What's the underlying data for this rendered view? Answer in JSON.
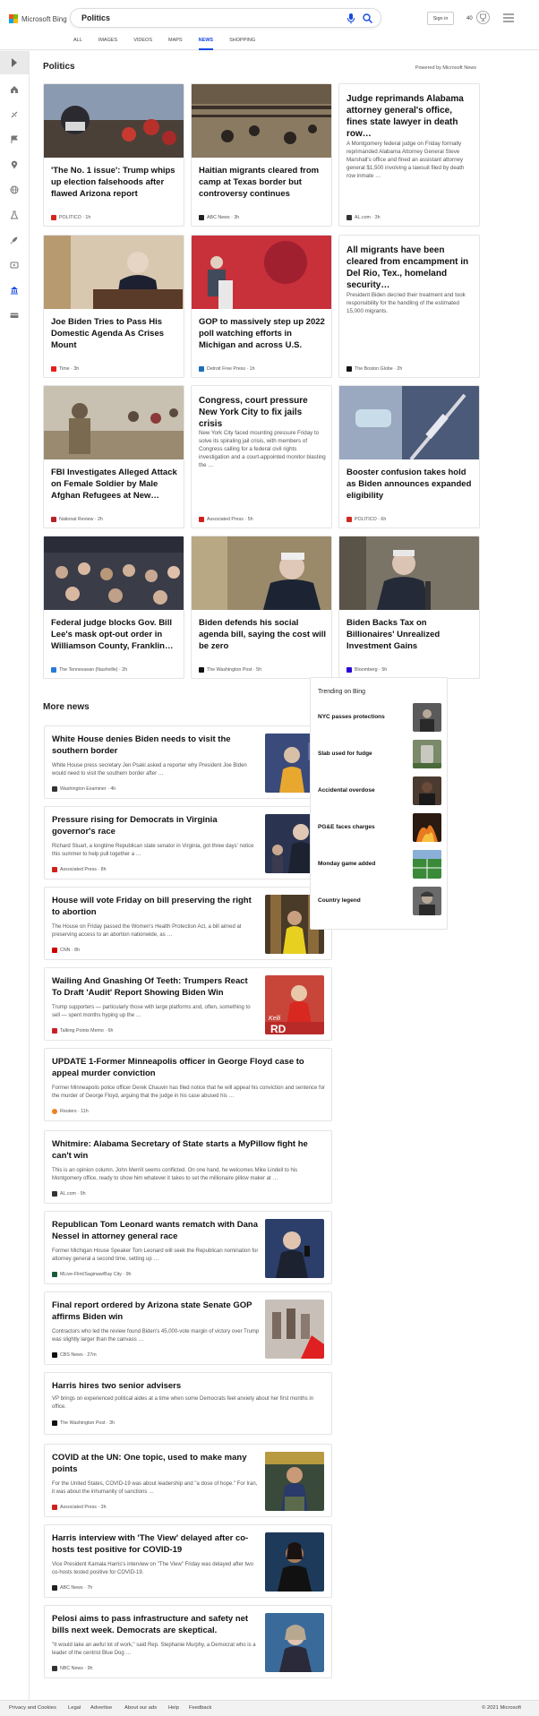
{
  "header": {
    "logo_text": "Microsoft Bing",
    "search_value": "Politics",
    "signin_label": "Sign in",
    "points": "40"
  },
  "nav": {
    "items": [
      "ALL",
      "IMAGES",
      "VIDEOS",
      "MAPS",
      "NEWS",
      "SHOPPING"
    ],
    "active": "NEWS"
  },
  "politics": {
    "title": "Politics",
    "powered_by": "Powered by Microsoft News",
    "cards": [
      {
        "title": "'The No. 1 issue': Trump whips up election falsehoods after flawed Arizona report",
        "source": "POLITICO · 1h",
        "color": "#c7b49a"
      },
      {
        "title": "Haitian migrants cleared from camp at Texas border but controversy continues",
        "source": "ABC News · 3h",
        "color": "#6b6252"
      },
      {
        "title": "Judge reprimands Alabama attorney general's office, fines state lawyer in death row…",
        "snippet": "A Montgomery federal judge on Friday formally reprimanded Alabama Attorney General Steve Marshall's office and fined an assistant attorney general $1,500 involving a lawsuit filed by death row inmate …",
        "source": "AL.com · 3h"
      },
      {
        "title": "Joe Biden Tries to Pass His Domestic Agenda As Crises Mount",
        "source": "Time · 3h",
        "color": "#c9a98a"
      },
      {
        "title": "GOP to massively step up 2022 poll watching efforts in Michigan and across U.S.",
        "source": "Detroit Free Press · 1h",
        "color": "#b8303a"
      },
      {
        "title": "All migrants have been cleared from encampment in Del Rio, Tex., homeland security…",
        "snippet": "President Biden decried their treatment and took responsibility for the handling of the estimated 15,000 migrants.",
        "source": "The Boston Globe · 2h"
      },
      {
        "title": "FBI Investigates Alleged Attack on Female Soldier by Male Afghan Refugees at New…",
        "source": "National Review · 2h",
        "color": "#a89a86"
      },
      {
        "title": "Congress, court pressure New York City to fix jails crisis",
        "snippet": "New York City faced mounting pressure Friday to solve its spiraling jail crisis, with members of Congress calling for a federal civil rights investigation and a court-appointed monitor blasting the …",
        "source": "Associated Press · 5h"
      },
      {
        "title": "Booster confusion takes hold as Biden announces expanded eligibility",
        "source": "POLITICO · 6h",
        "color": "#6a7a94"
      },
      {
        "title": "Federal judge blocks Gov. Bill Lee's mask opt-out order in Williamson County, Franklin…",
        "source": "The Tennessean (Nashville) · 2h",
        "color": "#4c4a55"
      },
      {
        "title": "Biden defends his social agenda bill, saying the cost will be zero",
        "source": "The Washington Post · 5h",
        "color": "#9a8a6a"
      },
      {
        "title": "Biden Backs Tax on Billionaires' Unrealized Investment Gains",
        "source": "Bloomberg · 5h",
        "color": "#7a7466"
      }
    ]
  },
  "more_news": {
    "title": "More news",
    "items": [
      {
        "title": "White House denies Biden needs to visit the southern border",
        "snippet": "White House press secretary Jen Psaki asked a reporter why President Joe Biden would need to visit the southern border after …",
        "source": "Washington Examiner · 4h",
        "thumb": "#3a4a7a"
      },
      {
        "title": "Pressure rising for Democrats in Virginia governor's race",
        "snippet": "Richard Stuart, a longtime Republican state senator in Virginia, got three days' notice this summer to help pull together a …",
        "source": "Associated Press · 8h",
        "thumb": "#2a3450"
      },
      {
        "title": "House will vote Friday on bill preserving the right to abortion",
        "snippet": "The House on Friday passed the Women's Health Protection Act, a bill aimed at preserving access to an abortion nationwide, as …",
        "source": "CNN · 8h",
        "thumb": "#4a3a28"
      },
      {
        "title": "Wailing And Gnashing Of Teeth: Trumpers React To Draft 'Audit' Report Showing Biden Win",
        "snippet": "Trump supporters — particularly those with large platforms and, often, something to sell — spent months hyping up the …",
        "source": "Talking Points Memo · 6h",
        "thumb": "#c8453a",
        "thumb_text": "Kelli\nRD"
      },
      {
        "title": "UPDATE 1-Former Minneapolis officer in George Floyd case to appeal murder conviction",
        "snippet": "Former Minneapolis police officer Derek Chauvin has filed notice that he will appeal his conviction and sentence for the murder of George Floyd, arguing that the judge in his case abused his …",
        "source": "Reuters · 11h"
      },
      {
        "title": "Whitmire: Alabama Secretary of State starts a MyPillow fight he can't win",
        "snippet": "This is an opinion column. John Merrill seems conflicted. On one hand, he welcomes Mike Lindell to his Montgomery office, ready to show him whatever it takes to set the millionaire pillow maker at …",
        "source": "AL.com · 9h"
      },
      {
        "title": "Republican Tom Leonard wants rematch with Dana Nessel in attorney general race",
        "snippet": "Former Michigan House Speaker Tom Leonard will seek the Republican nomination for attorney general a second time, setting up …",
        "source": "MLive-Flint/Saginaw/Bay City · 9h",
        "thumb": "#2c3e6a"
      },
      {
        "title": "Final report ordered by Arizona state Senate GOP affirms Biden win",
        "snippet": "Contractors who led the review found Biden's 45,000-vote margin of victory over Trump was slightly larger than the canvass …",
        "source": "CBS News · 27m",
        "thumb": "#8a7a70"
      },
      {
        "title": "Harris hires two senior advisers",
        "snippet": "VP brings on experienced political aides at a time when some Democrats feel anxiety about her first months in office.",
        "source": "The Washington Post · 3h"
      },
      {
        "title": "COVID at the UN: One topic, used to make many points",
        "snippet": "For the United States, COVID-19 was about leadership and \"a dose of hope.\" For Iran, it was about the inhumanity of sanctions …",
        "source": "Associated Press · 3h",
        "thumb": "#3a4a3a"
      },
      {
        "title": "Harris interview with 'The View' delayed after co-hosts test positive for COVID-19",
        "snippet": "Vice President Kamala Harris's interview on \"The View\" Friday was delayed after two co-hosts tested positive for COVID-19.",
        "source": "ABC News · 7h",
        "thumb": "#1e3a5a"
      },
      {
        "title": "Pelosi aims to pass infrastructure and safety net bills next week. Democrats are skeptical.",
        "snippet": "\"It would take an awful lot of work,\" said Rep. Stephanie Murphy, a Democrat who is a leader of the centrist Blue Dog …",
        "source": "NBC News · 9h",
        "thumb": "#3a6a9a"
      }
    ]
  },
  "trending": {
    "title": "Trending on Bing",
    "items": [
      {
        "label": "NYC passes protections",
        "thumb": "#5a5a5a"
      },
      {
        "label": "Slab used for fudge",
        "thumb": "#7a8a6a"
      },
      {
        "label": "Accidental overdose",
        "thumb": "#4a3a30"
      },
      {
        "label": "PG&E faces charges",
        "thumb": "#c86a20"
      },
      {
        "label": "Monday game added",
        "thumb": "#3a8a3a"
      },
      {
        "label": "Country legend",
        "thumb": "#6a6a6a"
      }
    ]
  },
  "footer": {
    "links": [
      "Privacy and Cookies",
      "Legal",
      "Advertise",
      "About our ads",
      "Help",
      "Feedback"
    ],
    "copyright": "© 2021 Microsoft"
  },
  "colors": {
    "accent": "#174ae4",
    "logo": [
      "#f25022",
      "#7fba00",
      "#00a4ef",
      "#ffb900"
    ]
  }
}
